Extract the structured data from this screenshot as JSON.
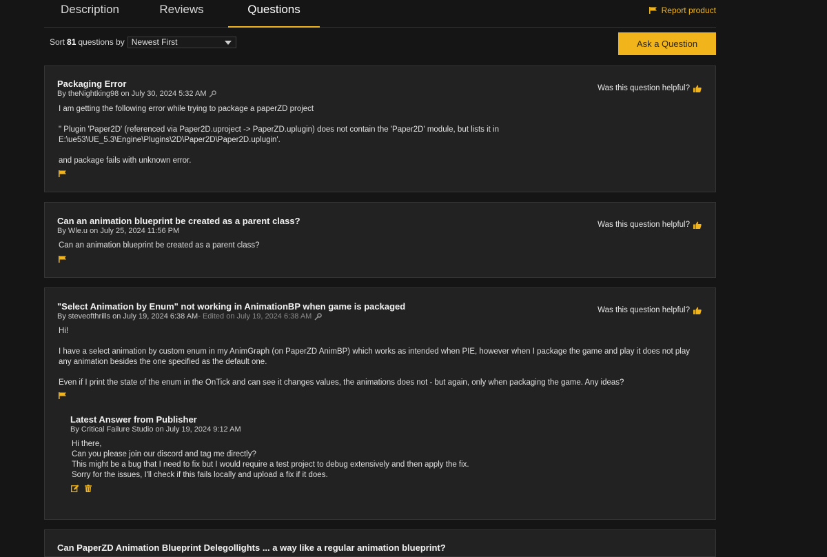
{
  "tabs": [
    {
      "label": "Description"
    },
    {
      "label": "Reviews"
    },
    {
      "label": "Questions"
    }
  ],
  "report_label": "Report product",
  "sort": {
    "prefix": "Sort",
    "count": "81",
    "suffix": "questions by",
    "selected": "Newest First"
  },
  "ask_button": "Ask a Question",
  "helpful_label": "Was this question helpful?",
  "questions": [
    {
      "title": "Packaging Error",
      "meta": "By theNightking98 on July 30, 2024 5:32 AM",
      "body": [
        "I am getting the following error while trying to package a paperZD project",
        "\" Plugin 'Paper2D' (referenced via Paper2D.uproject -> PaperZD.uplugin) does not contain the 'Paper2D' module, but lists it in E:\\ue53\\UE_5.3\\Engine\\Plugins\\2D\\Paper2D\\Paper2D.uplugin'.",
        "and package fails with unknown error."
      ]
    },
    {
      "title": "Can an animation blueprint be created as a parent class?",
      "meta": "By Wle.u on July 25, 2024 11:56 PM",
      "body": [
        "Can an animation blueprint be created as a parent class?"
      ]
    },
    {
      "title": "\"Select Animation by Enum\" not working in AnimationBP when game is packaged",
      "meta": "By steveofthrills on July 19, 2024 6:38 AM",
      "edited": " - Edited on July 19, 2024 6:38 AM",
      "body": [
        "Hi!",
        "I have a select animation by custom enum in my AnimGraph (on PaperZD AnimBP) which works as intended when PIE, however when I package the game and play it does not play any animation besides the one specified as the default one.",
        "Even if I print the state of the enum in the OnTick and can see it changes values, the animations does not - but again, only when packaging the game. Any ideas?"
      ],
      "answer": {
        "title": "Latest Answer from Publisher",
        "meta": "By Critical Failure Studio on July 19, 2024 9:12 AM",
        "lines": [
          "Hi there,",
          "Can you please join our discord and tag me directly?",
          "This might be a bug that I need to fix but I would require a test project to debug extensively and then apply the fix.",
          "Sorry for the issues, I'll check if this fails locally and upload a fix if it does."
        ]
      }
    },
    {
      "title": "Can PaperZD Animation Blueprint Delegollights ... a way like a regular animation blueprint?"
    }
  ],
  "colors": {
    "accent": "#f1b41a",
    "card_bg": "#222222",
    "page_bg": "#151515"
  }
}
